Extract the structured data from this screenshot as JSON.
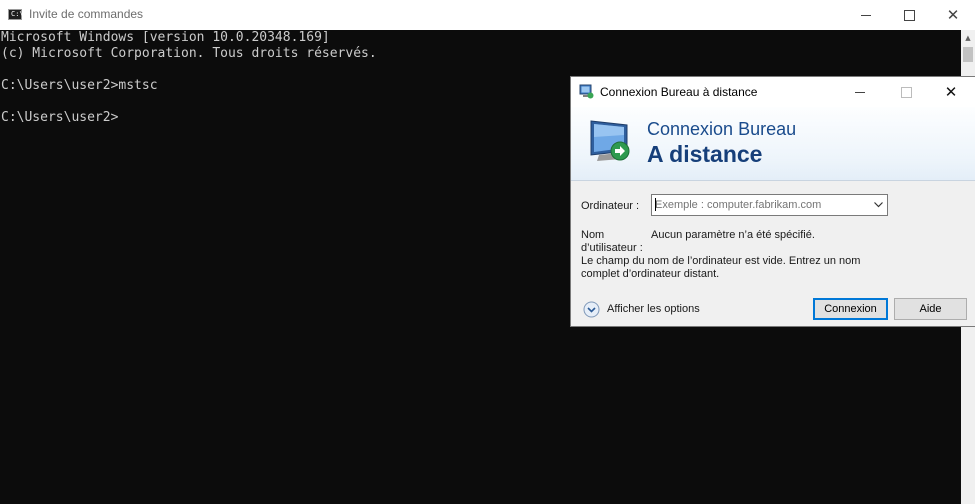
{
  "cmd": {
    "title": "Invite de commandes",
    "icon_text": "C:\\",
    "lines": [
      "Microsoft Windows [version 10.0.20348.169]",
      "(c) Microsoft Corporation. Tous droits réservés.",
      "",
      "C:\\Users\\user2>mstsc",
      "",
      "C:\\Users\\user2>"
    ],
    "colors": {
      "background": "#0c0c0c",
      "text": "#cccccc"
    }
  },
  "rdp": {
    "title": "Connexion Bureau à distance",
    "banner_line1": "Connexion Bureau",
    "banner_line2": "A distance",
    "computer_label": "Ordinateur :",
    "computer_placeholder": "Exemple : computer.fabrikam.com",
    "computer_value": "",
    "user_label": "Nom d’utilisateur :",
    "user_value": "Aucun paramètre n’a été spécifié.",
    "warning": "Le champ du nom de l’ordinateur est vide. Entrez un nom complet d’ordinateur distant.",
    "options_label": "Afficher les options",
    "connect_label": "Connexion",
    "help_label": "Aide",
    "colors": {
      "accent": "#0078d7",
      "heading": "#1a4b8c"
    }
  }
}
